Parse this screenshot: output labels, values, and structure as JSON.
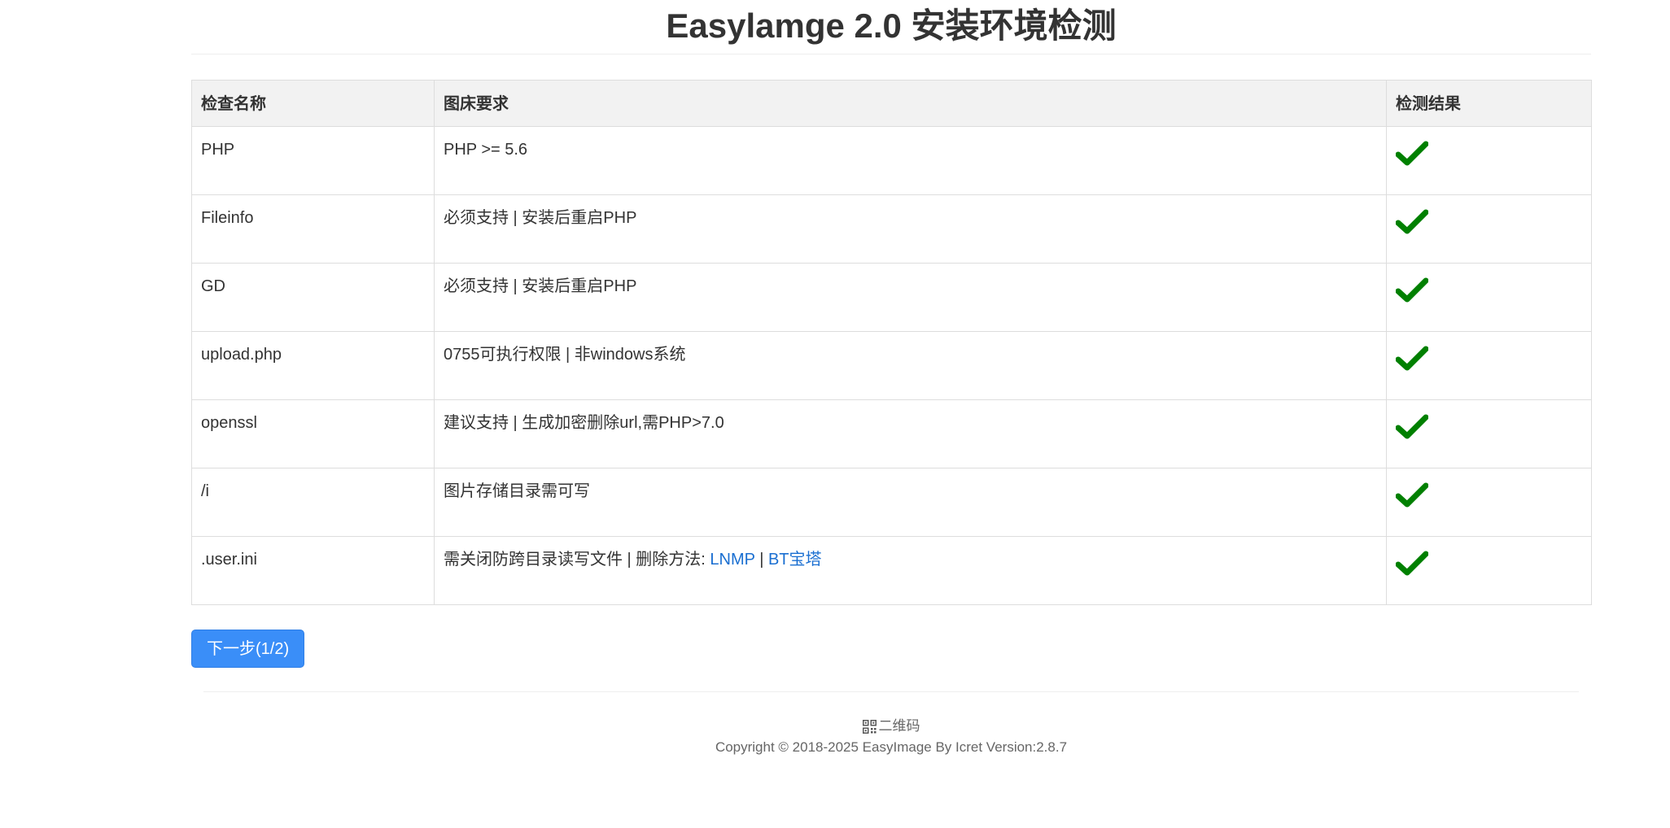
{
  "page": {
    "title": "Easylamge 2.0 安装环境检测"
  },
  "table": {
    "headers": [
      "检查名称",
      "图床要求",
      "检测结果"
    ],
    "rows": [
      {
        "name": "PHP",
        "requirement": "PHP >= 5.6",
        "result": "pass"
      },
      {
        "name": "Fileinfo",
        "requirement": "必须支持 | 安装后重启PHP",
        "result": "pass"
      },
      {
        "name": "GD",
        "requirement": "必须支持 | 安装后重启PHP",
        "result": "pass"
      },
      {
        "name": "upload.php",
        "requirement": "0755可执行权限 | 非windows系统",
        "result": "pass"
      },
      {
        "name": "openssl",
        "requirement": "建议支持 | 生成加密删除url,需PHP>7.0",
        "result": "pass"
      },
      {
        "name": "/i",
        "requirement": "图片存储目录需可写",
        "result": "pass"
      },
      {
        "name": ".user.ini",
        "requirement_prefix": "需关闭防跨目录读写文件 | 删除方法: ",
        "link_lnmp": "LNMP",
        "separator": " | ",
        "link_bt": "BT宝塔",
        "result": "pass"
      }
    ],
    "result_icon": "checkmark-icon",
    "result_color": "#008000"
  },
  "actions": {
    "next_label": "下一步(1/2)",
    "next_color": "#3a8ef8"
  },
  "footer": {
    "qr_icon": "qrcode-icon",
    "qr_label": "二维码",
    "copyright": "Copyright © 2018-2025 EasyImage By Icret Version:2.8.7"
  }
}
